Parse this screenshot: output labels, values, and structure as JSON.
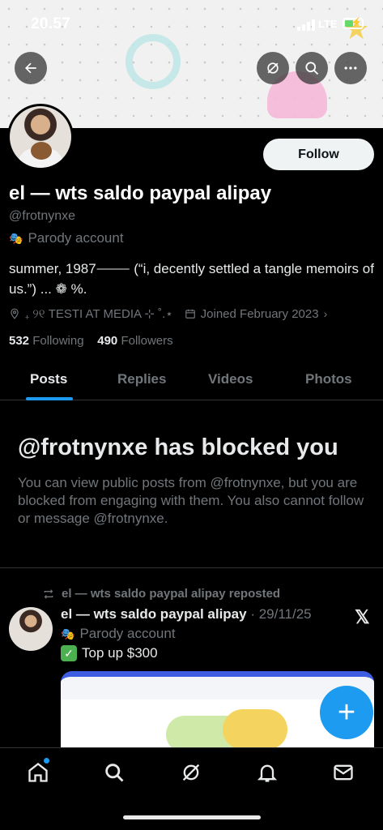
{
  "status_bar": {
    "time": "20.57",
    "network": "LTE"
  },
  "profile": {
    "display_name": "el — wts saldo paypal alipay",
    "handle": "@frotnynxe",
    "parody_label": "Parody account",
    "bio": "summer, 1987⸻ (“i, decently settled a tangle memoirs of us.”) ... ❁ %.",
    "location": "₊ ୨୧ TESTI AT MEDIA ⊹ ˚.⋆",
    "joined": "Joined February 2023",
    "following_count": "532",
    "following_label": "Following",
    "followers_count": "490",
    "followers_label": "Followers",
    "follow_label": "Follow"
  },
  "tabs": [
    "Posts",
    "Replies",
    "Videos",
    "Photos"
  ],
  "blocked": {
    "title": "@frotnynxe has blocked you",
    "body": "You can view public posts from @frotnynxe, but you are blocked from engaging with them. You also cannot follow or message @frotnynxe."
  },
  "post": {
    "repost_label": "el — wts saldo paypal alipay reposted",
    "author": "el — wts saldo paypal alipay",
    "date": "· 29/11/25",
    "parody_label": "Parody account",
    "text": "Top up $300",
    "x_logo": "𝕏"
  },
  "fab": {
    "label": "+"
  },
  "icons": {
    "back": "back-arrow-icon",
    "grok": "grok-icon",
    "search": "search-icon",
    "more": "more-icon",
    "location": "location-icon",
    "calendar": "calendar-icon",
    "repost": "repost-icon",
    "nav": [
      "home-icon",
      "search-icon",
      "grok-icon",
      "notifications-icon",
      "messages-icon"
    ]
  },
  "colors": {
    "accent": "#1d9bf0",
    "background": "#000000",
    "muted": "#71767b"
  }
}
